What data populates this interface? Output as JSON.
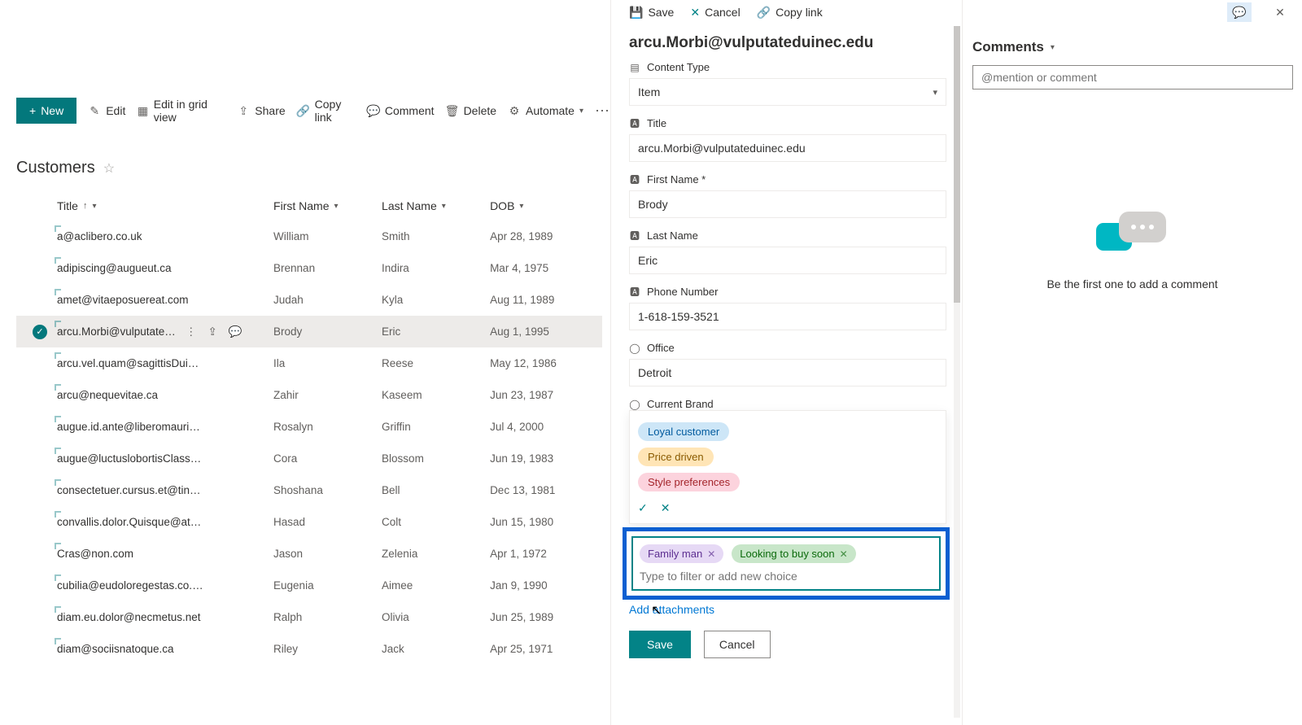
{
  "toolbar": {
    "new_label": "New",
    "edit_label": "Edit",
    "grid_label": "Edit in grid view",
    "share_label": "Share",
    "copylink_label": "Copy link",
    "comment_label": "Comment",
    "delete_label": "Delete",
    "automate_label": "Automate"
  },
  "list": {
    "title": "Customers",
    "columns": {
      "title": "Title",
      "first_name": "First Name",
      "last_name": "Last Name",
      "dob": "DOB"
    },
    "rows": [
      {
        "title": "a@aclibero.co.uk",
        "first_name": "William",
        "last_name": "Smith",
        "dob": "Apr 28, 1989"
      },
      {
        "title": "adipiscing@augueut.ca",
        "first_name": "Brennan",
        "last_name": "Indira",
        "dob": "Mar 4, 1975"
      },
      {
        "title": "amet@vitaeposuereat.com",
        "first_name": "Judah",
        "last_name": "Kyla",
        "dob": "Aug 11, 1989"
      },
      {
        "title": "arcu.Morbi@vulputatedu...",
        "first_name": "Brody",
        "last_name": "Eric",
        "dob": "Aug 1, 1995"
      },
      {
        "title": "arcu.vel.quam@sagittisDuisgravida.com",
        "first_name": "Ila",
        "last_name": "Reese",
        "dob": "May 12, 1986"
      },
      {
        "title": "arcu@nequevitae.ca",
        "first_name": "Zahir",
        "last_name": "Kaseem",
        "dob": "Jun 23, 1987"
      },
      {
        "title": "augue.id.ante@liberomaurisaliquam.co.uk",
        "first_name": "Rosalyn",
        "last_name": "Griffin",
        "dob": "Jul 4, 2000"
      },
      {
        "title": "augue@luctuslobortisClass.co.uk",
        "first_name": "Cora",
        "last_name": "Blossom",
        "dob": "Jun 19, 1983"
      },
      {
        "title": "consectetuer.cursus.et@tinciduntDonec.co.uk",
        "first_name": "Shoshana",
        "last_name": "Bell",
        "dob": "Dec 13, 1981"
      },
      {
        "title": "convallis.dolor.Quisque@at.co.uk",
        "first_name": "Hasad",
        "last_name": "Colt",
        "dob": "Jun 15, 1980"
      },
      {
        "title": "Cras@non.com",
        "first_name": "Jason",
        "last_name": "Zelenia",
        "dob": "Apr 1, 1972"
      },
      {
        "title": "cubilia@eudoloregestas.co.uk",
        "first_name": "Eugenia",
        "last_name": "Aimee",
        "dob": "Jan 9, 1990"
      },
      {
        "title": "diam.eu.dolor@necmetus.net",
        "first_name": "Ralph",
        "last_name": "Olivia",
        "dob": "Jun 25, 1989"
      },
      {
        "title": "diam@sociisnatoque.ca",
        "first_name": "Riley",
        "last_name": "Jack",
        "dob": "Apr 25, 1971"
      }
    ],
    "selected_index": 3
  },
  "panel": {
    "toolbar": {
      "save": "Save",
      "cancel": "Cancel",
      "copylink": "Copy link"
    },
    "title": "arcu.Morbi@vulputateduinec.edu",
    "fields": {
      "content_type": {
        "label": "Content Type",
        "value": "Item"
      },
      "title": {
        "label": "Title",
        "value": "arcu.Morbi@vulputateduinec.edu"
      },
      "first_name": {
        "label": "First Name *",
        "value": "Brody"
      },
      "last_name": {
        "label": "Last Name",
        "value": "Eric"
      },
      "phone": {
        "label": "Phone Number",
        "value": "1-618-159-3521"
      },
      "office": {
        "label": "Office",
        "value": "Detroit"
      },
      "current_brand": {
        "label": "Current Brand"
      }
    },
    "dropdown_choices": {
      "opt1": "Loyal customer",
      "opt2": "Price driven",
      "opt3": "Style preferences"
    },
    "tags": {
      "tag1": "Family man",
      "tag2": "Looking to buy soon",
      "placeholder": "Type to filter or add new choice"
    },
    "add_attachments": "Add attachments",
    "footer": {
      "save": "Save",
      "cancel": "Cancel"
    }
  },
  "comments": {
    "title": "Comments",
    "placeholder": "@mention or comment",
    "empty_text": "Be the first one to add a comment"
  }
}
